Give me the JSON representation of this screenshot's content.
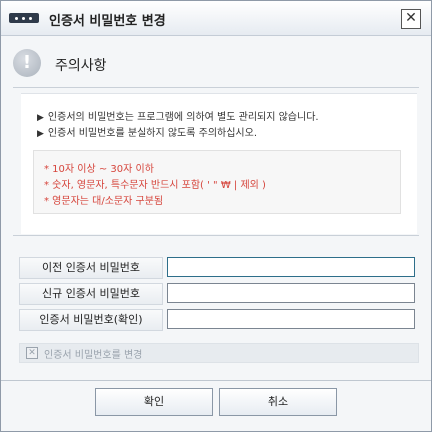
{
  "window": {
    "title": "인증서 비밀번호 변경",
    "close_symbol": "✕"
  },
  "notice": {
    "icon_symbol": "!",
    "title": "주의사항",
    "bullets": [
      "인증서의 비밀번호는 프로그램에 의하여 별도 관리되지 않습니다.",
      "인증서 비밀번호를 분실하지 않도록 주의하십시오."
    ],
    "rules": [
      "* 10자 이상 ~ 30자 이하",
      "* 숫자, 영문자, 특수문자 반드시 포함( ' \" ₩ | 제외 )",
      "* 영문자는 대/소문자 구분됨"
    ]
  },
  "form": {
    "old_password_label": "이전 인증서 비밀번호",
    "old_password_value": "",
    "new_password_label": "신규 인증서 비밀번호",
    "new_password_value": "",
    "confirm_password_label": "인증서 비밀번호(확인)",
    "confirm_password_value": ""
  },
  "option": {
    "checkbox_label": "인증서 비밀번호를 변경",
    "checked": false
  },
  "buttons": {
    "ok": "확인",
    "cancel": "취소"
  },
  "colors": {
    "accent_red": "#d6453c",
    "focus_border": "#2d6e8a"
  }
}
